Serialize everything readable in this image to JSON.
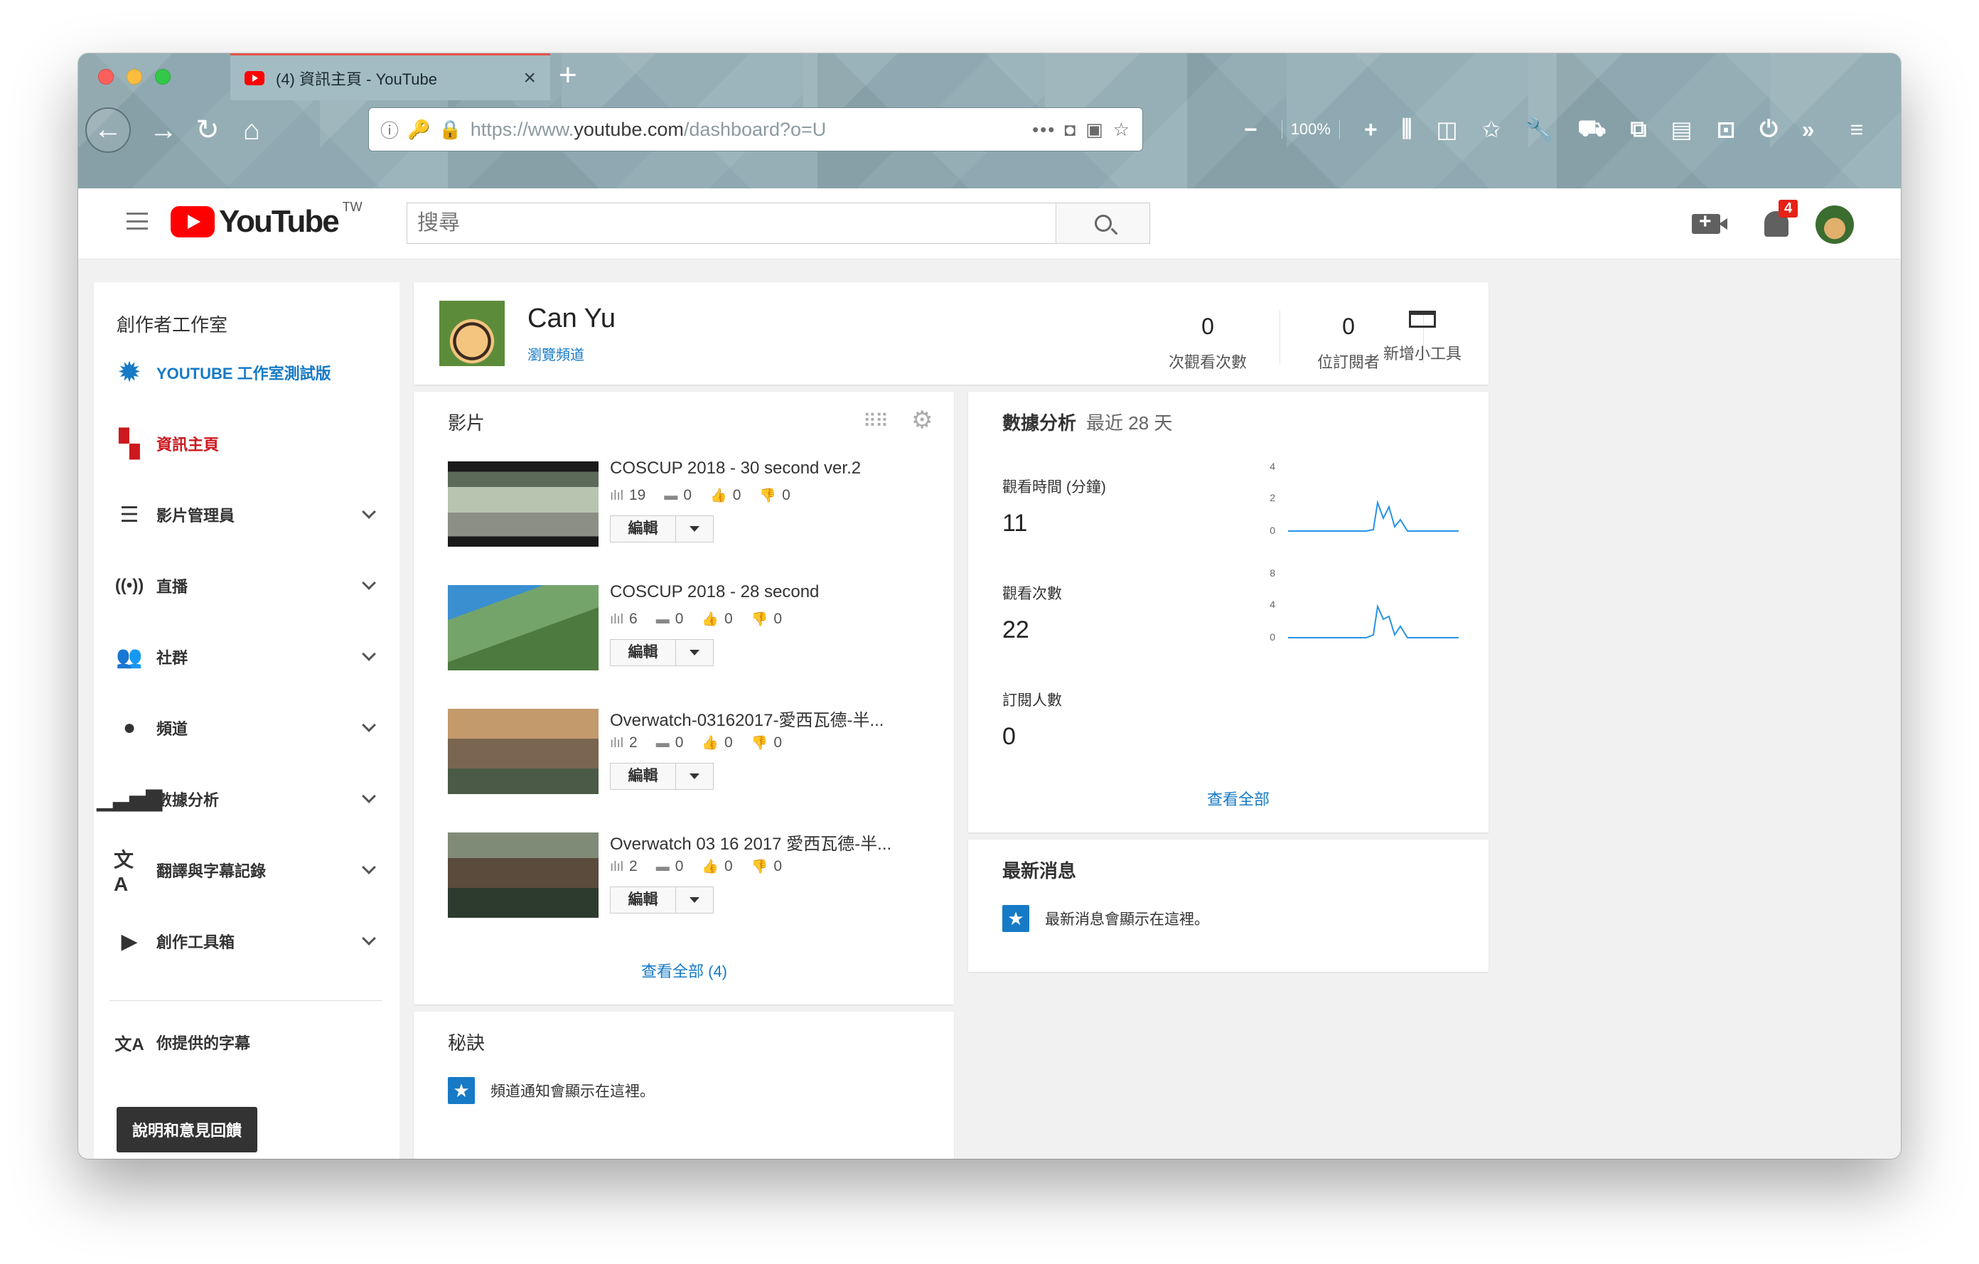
{
  "browser": {
    "tab_title": "(4) 資訊主頁 - YouTube",
    "url_prefix": "https://www.",
    "url_host": "youtube.com",
    "url_path": "/dashboard?o=U",
    "zoom": "100%",
    "url_more": "•••"
  },
  "masthead": {
    "logo_text": "YouTube",
    "logo_region": "TW",
    "search_placeholder": "搜尋",
    "notification_count": "4"
  },
  "sidebar": {
    "title": "創作者工作室",
    "items": [
      {
        "label": "YOUTUBE 工作室測試版",
        "icon": "gear-icon"
      },
      {
        "label": "資訊主頁",
        "icon": "dashboard-icon"
      },
      {
        "label": "影片管理員",
        "icon": "video-manager-icon"
      },
      {
        "label": "直播",
        "icon": "live-icon"
      },
      {
        "label": "社群",
        "icon": "community-icon"
      },
      {
        "label": "頻道",
        "icon": "channel-icon"
      },
      {
        "label": "數據分析",
        "icon": "analytics-icon"
      },
      {
        "label": "翻譯與字幕記錄",
        "icon": "translate-icon"
      },
      {
        "label": "創作工具箱",
        "icon": "create-icon"
      }
    ],
    "subtitles_label": "你提供的字幕",
    "help_button": "說明和意見回饋"
  },
  "profile": {
    "name": "Can Yu",
    "link": "瀏覽頻道",
    "stats": [
      {
        "value": "0",
        "label": "次觀看次數"
      },
      {
        "value": "0",
        "label": "位訂閱者"
      }
    ],
    "add_widget_label": "新增小工具"
  },
  "videos": {
    "title": "影片",
    "edit_label": "編輯",
    "see_all": "查看全部 (4)",
    "items": [
      {
        "title": "COSCUP 2018 - 30 second ver.2",
        "views": "19",
        "comments": "0",
        "likes": "0",
        "dislikes": "0"
      },
      {
        "title": "COSCUP 2018 - 28 second",
        "views": "6",
        "comments": "0",
        "likes": "0",
        "dislikes": "0"
      },
      {
        "title": "Overwatch-03162017-愛西瓦德-半...",
        "views": "2",
        "comments": "0",
        "likes": "0",
        "dislikes": "0"
      },
      {
        "title": "Overwatch 03 16 2017 愛西瓦德-半...",
        "views": "2",
        "comments": "0",
        "likes": "0",
        "dislikes": "0"
      }
    ]
  },
  "tips": {
    "title": "秘訣",
    "message": "頻道通知會顯示在這裡。"
  },
  "analytics": {
    "title": "數據分析",
    "period": "最近 28 天",
    "see_all": "查看全部",
    "metrics": [
      {
        "label": "觀看時間 (分鐘)",
        "value": "11",
        "ticks": [
          "4",
          "2",
          "0"
        ]
      },
      {
        "label": "觀看次數",
        "value": "22",
        "ticks": [
          "8",
          "4",
          "0"
        ]
      },
      {
        "label": "訂閱人數",
        "value": "0"
      }
    ],
    "spark_color": "#2793e8"
  },
  "news": {
    "title": "最新消息",
    "message": "最新消息會顯示在這裡。"
  }
}
